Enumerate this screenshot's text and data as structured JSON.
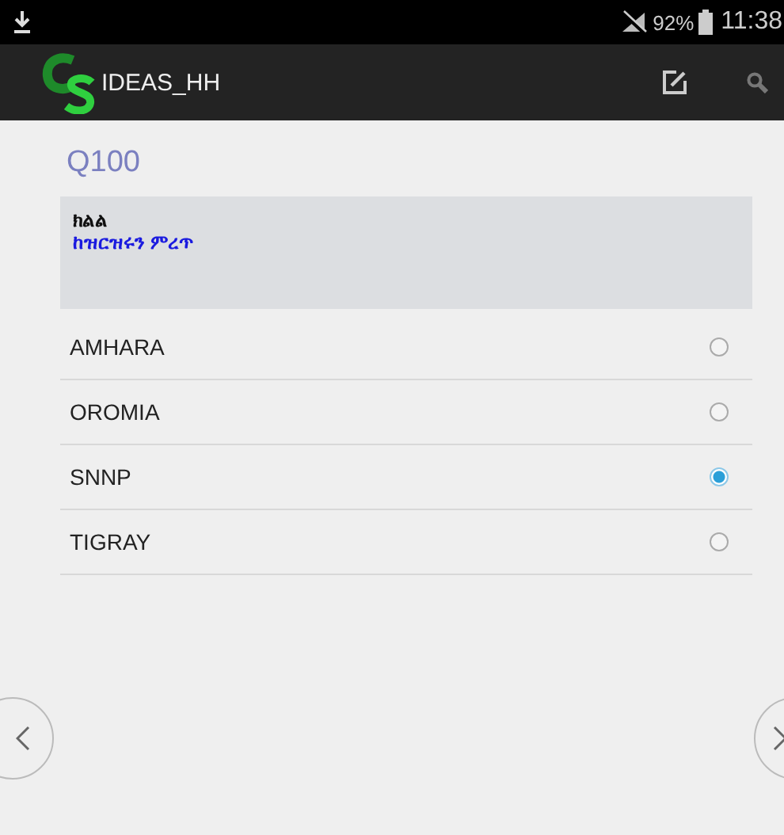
{
  "status_bar": {
    "battery": "92%",
    "time": "11:38"
  },
  "app_bar": {
    "title": "IDEAS_HH"
  },
  "question": {
    "code": "Q100",
    "label": "ክልል",
    "hint": "ከዝርዝሩን ምረጥ"
  },
  "options": [
    {
      "label": "AMHARA",
      "selected": false
    },
    {
      "label": "OROMIA",
      "selected": false
    },
    {
      "label": "SNNP",
      "selected": true
    },
    {
      "label": "TIGRAY",
      "selected": false
    }
  ]
}
